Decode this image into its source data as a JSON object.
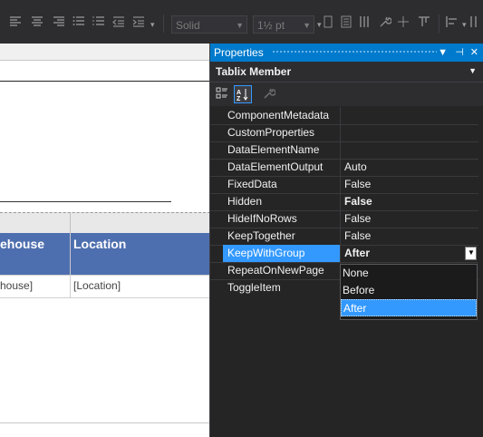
{
  "toolbar": {
    "border_style": "Solid",
    "border_width": "1½ pt"
  },
  "designer": {
    "columns": [
      "ehouse",
      "Location"
    ],
    "cells": [
      "house]",
      "[Location]"
    ]
  },
  "panel": {
    "title": "Properties",
    "object_name": "Tablix Member",
    "buttons": [
      "▼",
      "⊣",
      "✕"
    ]
  },
  "properties": [
    {
      "name": "ComponentMetadata",
      "value": ""
    },
    {
      "name": "CustomProperties",
      "value": ""
    },
    {
      "name": "DataElementName",
      "value": ""
    },
    {
      "name": "DataElementOutput",
      "value": "Auto"
    },
    {
      "name": "FixedData",
      "value": "False"
    },
    {
      "name": "Hidden",
      "value": "False"
    },
    {
      "name": "HideIfNoRows",
      "value": "False"
    },
    {
      "name": "KeepTogether",
      "value": "False"
    },
    {
      "name": "KeepWithGroup",
      "value": "After"
    },
    {
      "name": "RepeatOnNewPage",
      "value": ""
    },
    {
      "name": "ToggleItem",
      "value": ""
    }
  ],
  "dropdown": {
    "options": [
      "None",
      "Before",
      "After"
    ],
    "selected": "After"
  },
  "colors": {
    "accent": "#007acc",
    "selection": "#3399ff",
    "header_fill": "#4e6faf"
  }
}
